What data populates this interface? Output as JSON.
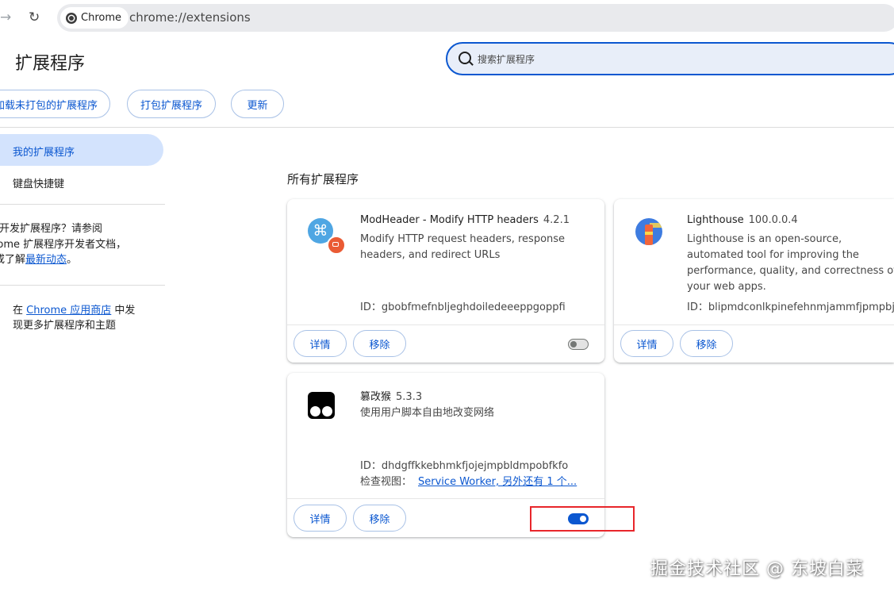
{
  "browser": {
    "forward_icon": "arrow-right-icon",
    "reload_icon": "reload-icon",
    "chip_label": "Chrome",
    "url": "chrome://extensions"
  },
  "header": {
    "title": "扩展程序",
    "search_placeholder": "搜索扩展程序"
  },
  "toolbar": {
    "load_unpacked": "加载未打包的扩展程序",
    "pack": "打包扩展程序",
    "update": "更新"
  },
  "sidebar": {
    "items": [
      {
        "label": "我的扩展程序",
        "active": true
      },
      {
        "label": "键盘快捷键",
        "active": false
      }
    ],
    "dev_line1": "在开发扩展程序？请参阅",
    "dev_line2": "Chrome 扩展程序开发者文档，",
    "dev_line3_prefix": "或了解",
    "dev_link": "最新动态",
    "dev_line3_suffix": "。",
    "store_prefix": "在",
    "store_link": "Chrome 应用商店",
    "store_suffix": "中发",
    "store_line2": "现更多扩展程序和主题"
  },
  "main": {
    "section_title": "所有扩展程序",
    "details_label": "详情",
    "remove_label": "移除",
    "id_prefix": "ID：",
    "inspect_prefix": "检查视图：",
    "extensions": [
      {
        "name": "ModHeader - Modify HTTP headers",
        "version": "4.2.1",
        "description": "Modify HTTP request headers, response headers, and redirect URLs",
        "id": "gbobfmefnbljeghdoiledeeeppgoppfi",
        "enabled": false,
        "icon": "modheader-icon"
      },
      {
        "name": "Lighthouse",
        "version": "100.0.0.4",
        "description": "Lighthouse is an open-source, automated tool for improving the performance, quality, and correctness of your web apps.",
        "id": "blipmdconlkpinefehnmjammfjpmpbjk",
        "enabled": true,
        "icon": "lighthouse-icon"
      },
      {
        "name": "篡改猴",
        "version": "5.3.3",
        "description": "使用用户脚本自由地改变网络",
        "id": "dhdgffkkebhmkfjojejmpbldmpobfkfo",
        "inspect_link": "Service Worker, 另外还有 1 个...",
        "enabled": true,
        "icon": "tampermonkey-icon"
      }
    ]
  },
  "annotation": {
    "color": "#e8262b"
  },
  "watermark": "掘金技术社区 @ 东坡白菜"
}
